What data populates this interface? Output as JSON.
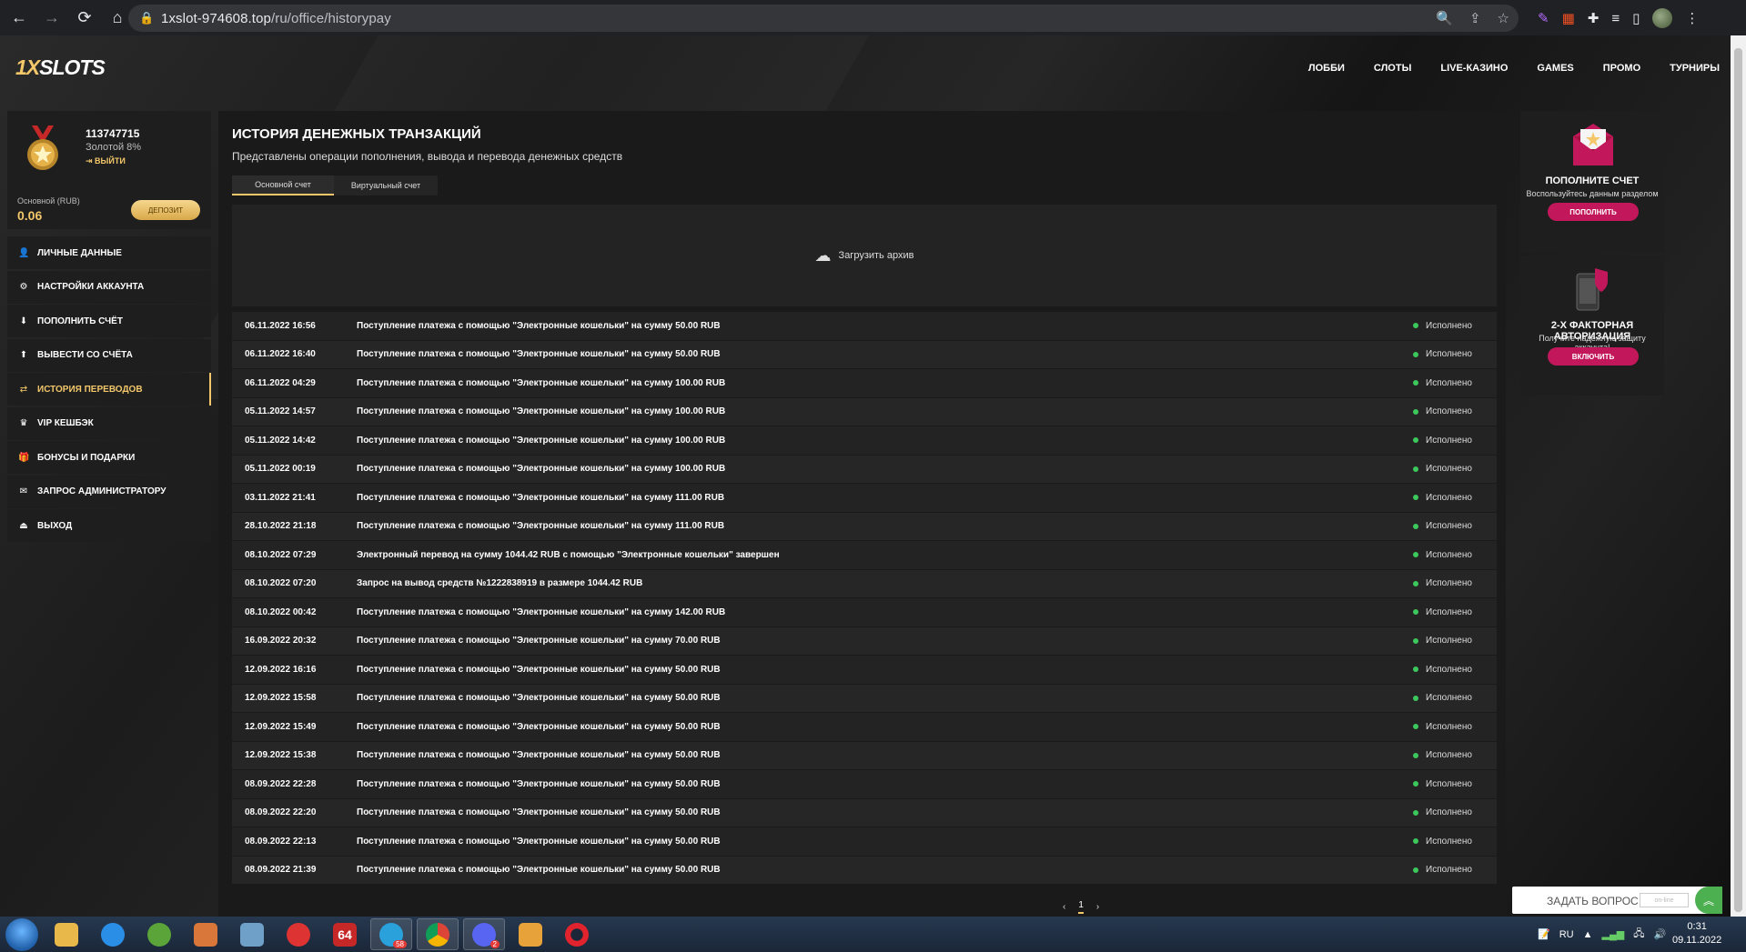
{
  "browser": {
    "url_host": "1xslot-974608.top",
    "url_path": "/ru/office/historypay"
  },
  "site": {
    "logo_prefix": "1X",
    "logo_suffix": "SLOTS",
    "nav": [
      "ЛОББИ",
      "СЛОТЫ",
      "LIVE-КАЗИНО",
      "GAMES",
      "ПРОМО",
      "ТУРНИРЫ"
    ]
  },
  "profile": {
    "user_id": "113747715",
    "level": "Золотой 8%",
    "logout": "ВЫЙТИ",
    "balance_label": "Основной (RUB)",
    "balance_value": "0.06",
    "deposit_button": "ДЕПОЗИТ"
  },
  "menu": [
    {
      "label": "ЛИЧНЫЕ ДАННЫЕ",
      "icon": "user-icon",
      "glyph": "👤"
    },
    {
      "label": "НАСТРОЙКИ АККАУНТА",
      "icon": "gear-icon",
      "glyph": "⚙"
    },
    {
      "label": "ПОПОЛНИТЬ СЧЁТ",
      "icon": "download-icon",
      "glyph": "⬇"
    },
    {
      "label": "ВЫВЕСТИ СО СЧЁТА",
      "icon": "upload-icon",
      "glyph": "⬆"
    },
    {
      "label": "ИСТОРИЯ ПЕРЕВОДОВ",
      "icon": "transfer-icon",
      "glyph": "⇄"
    },
    {
      "label": "VIP КЕШБЭК",
      "icon": "crown-icon",
      "glyph": "♛"
    },
    {
      "label": "БОНУСЫ И ПОДАРКИ",
      "icon": "gift-icon",
      "glyph": "🎁"
    },
    {
      "label": "ЗАПРОС АДМИНИСТРАТОРУ",
      "icon": "mail-icon",
      "glyph": "✉"
    },
    {
      "label": "ВЫХОД",
      "icon": "exit-icon",
      "glyph": "⏏"
    }
  ],
  "main": {
    "title": "ИСТОРИЯ ДЕНЕЖНЫХ ТРАНЗАКЦИЙ",
    "subtitle": "Представлены операции пополнения, вывода и перевода денежных средств",
    "tabs": [
      "Основной счет",
      "Виртуальный счет"
    ],
    "archive_label": "Загрузить архив",
    "transactions": [
      {
        "date": "06.11.2022 16:56",
        "desc": "Поступление платежа с помощью \"Электронные кошельки\" на сумму 50.00 RUB",
        "status": "Исполнено"
      },
      {
        "date": "06.11.2022 16:40",
        "desc": "Поступление платежа с помощью \"Электронные кошельки\" на сумму 50.00 RUB",
        "status": "Исполнено"
      },
      {
        "date": "06.11.2022 04:29",
        "desc": "Поступление платежа с помощью \"Электронные кошельки\" на сумму 100.00 RUB",
        "status": "Исполнено"
      },
      {
        "date": "05.11.2022 14:57",
        "desc": "Поступление платежа с помощью \"Электронные кошельки\" на сумму 100.00 RUB",
        "status": "Исполнено"
      },
      {
        "date": "05.11.2022 14:42",
        "desc": "Поступление платежа с помощью \"Электронные кошельки\" на сумму 100.00 RUB",
        "status": "Исполнено"
      },
      {
        "date": "05.11.2022 00:19",
        "desc": "Поступление платежа с помощью \"Электронные кошельки\" на сумму 100.00 RUB",
        "status": "Исполнено"
      },
      {
        "date": "03.11.2022 21:41",
        "desc": "Поступление платежа с помощью \"Электронные кошельки\" на сумму 111.00 RUB",
        "status": "Исполнено"
      },
      {
        "date": "28.10.2022 21:18",
        "desc": "Поступление платежа с помощью \"Электронные кошельки\" на сумму 111.00 RUB",
        "status": "Исполнено"
      },
      {
        "date": "08.10.2022 07:29",
        "desc": "Электронный перевод на сумму 1044.42 RUB с помощью \"Электронные кошельки\" завершен",
        "status": "Исполнено"
      },
      {
        "date": "08.10.2022 07:20",
        "desc": "Запрос на вывод средств №1222838919 в размере 1044.42 RUB",
        "status": "Исполнено"
      },
      {
        "date": "08.10.2022 00:42",
        "desc": "Поступление платежа с помощью \"Электронные кошельки\" на сумму 142.00 RUB",
        "status": "Исполнено"
      },
      {
        "date": "16.09.2022 20:32",
        "desc": "Поступление платежа с помощью \"Электронные кошельки\" на сумму 70.00 RUB",
        "status": "Исполнено"
      },
      {
        "date": "12.09.2022 16:16",
        "desc": "Поступление платежа с помощью \"Электронные кошельки\" на сумму 50.00 RUB",
        "status": "Исполнено"
      },
      {
        "date": "12.09.2022 15:58",
        "desc": "Поступление платежа с помощью \"Электронные кошельки\" на сумму 50.00 RUB",
        "status": "Исполнено"
      },
      {
        "date": "12.09.2022 15:49",
        "desc": "Поступление платежа с помощью \"Электронные кошельки\" на сумму 50.00 RUB",
        "status": "Исполнено"
      },
      {
        "date": "12.09.2022 15:38",
        "desc": "Поступление платежа с помощью \"Электронные кошельки\" на сумму 50.00 RUB",
        "status": "Исполнено"
      },
      {
        "date": "08.09.2022 22:28",
        "desc": "Поступление платежа с помощью \"Электронные кошельки\" на сумму 50.00 RUB",
        "status": "Исполнено"
      },
      {
        "date": "08.09.2022 22:20",
        "desc": "Поступление платежа с помощью \"Электронные кошельки\" на сумму 50.00 RUB",
        "status": "Исполнено"
      },
      {
        "date": "08.09.2022 22:13",
        "desc": "Поступление платежа с помощью \"Электронные кошельки\" на сумму 50.00 RUB",
        "status": "Исполнено"
      },
      {
        "date": "08.09.2022 21:39",
        "desc": "Поступление платежа с помощью \"Электронные кошельки\" на сумму 50.00 RUB",
        "status": "Исполнено"
      }
    ],
    "pagination": {
      "prev": "‹",
      "current": "1",
      "next": "›"
    }
  },
  "promo": {
    "card1": {
      "title": "ПОПОЛНИТЕ СЧЕТ",
      "desc": "Воспользуйтесь данным разделом",
      "button": "ПОПОЛНИТЬ"
    },
    "card2": {
      "title": "2-Х ФАКТОРНАЯ АВТОРИЗАЦИЯ",
      "desc": "Получите надёжную защиту аккаунта!",
      "button": "ВКЛЮЧИТЬ"
    }
  },
  "support": {
    "label": "ЗАДАТЬ ВОПРОС",
    "status": "on-line"
  },
  "taskbar": {
    "lang": "RU",
    "time": "0:31",
    "date": "09.11.2022",
    "badges": {
      "telegram": "58",
      "discord": "2"
    },
    "apps": [
      "explorer",
      "internet-explorer",
      "utorrent",
      "media-player",
      "control-panel",
      "ccleaner",
      "aida64",
      "telegram",
      "chrome",
      "discord",
      "dlink",
      "opera"
    ]
  },
  "colors": {
    "accent": "#f3c76a",
    "promo_button": "#c2185b",
    "status_ok": "#3cc85c"
  }
}
